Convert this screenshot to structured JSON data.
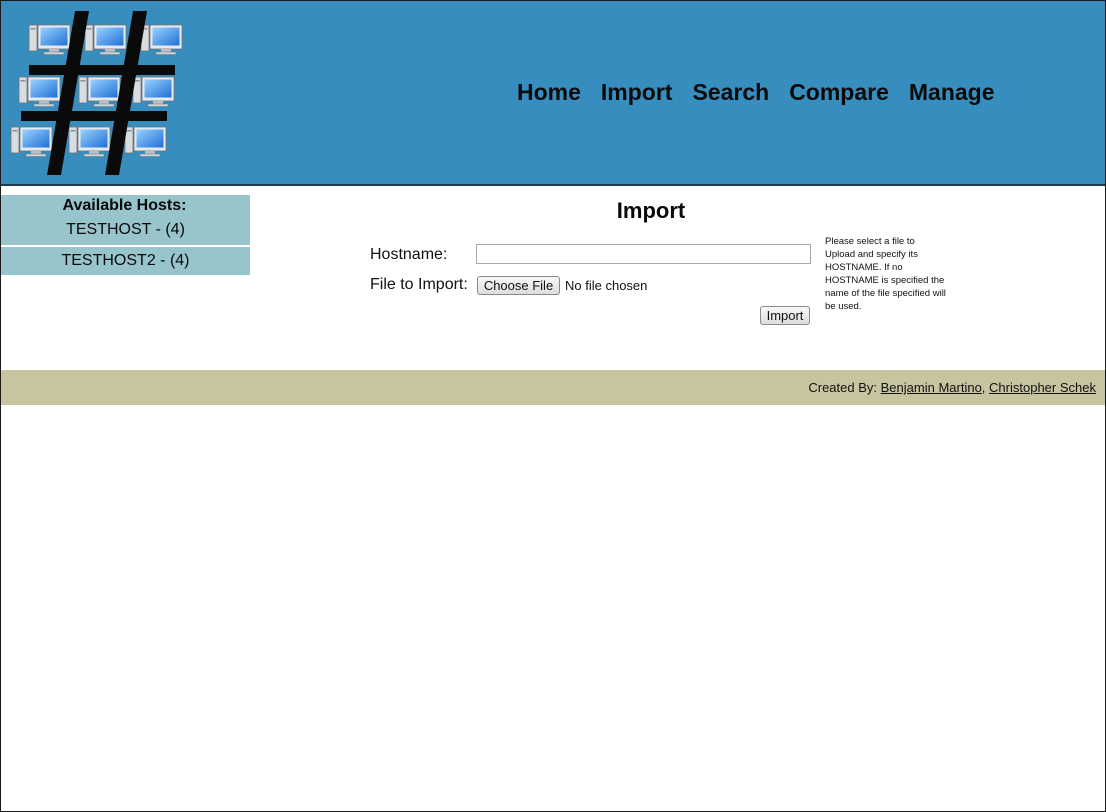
{
  "header": {
    "logo_icon": "hash-network-computers-icon",
    "nav": [
      {
        "label": "Home"
      },
      {
        "label": "Import"
      },
      {
        "label": "Search"
      },
      {
        "label": "Compare"
      },
      {
        "label": "Manage"
      }
    ]
  },
  "sidebar": {
    "title": "Available Hosts:",
    "hosts": [
      {
        "label": "TESTHOST - (4)"
      },
      {
        "label": "TESTHOST2 - (4)"
      }
    ]
  },
  "main": {
    "title": "Import",
    "hostname_label": "Hostname:",
    "hostname_value": "",
    "file_label": "File to Import:",
    "choose_file_label": "Choose File",
    "no_file_text": "No file chosen",
    "import_button_label": "Import",
    "help_text": "Please select a file to Upload and specify its HOSTNAME. If no HOSTNAME is specified the name of the file specified will be used."
  },
  "footer": {
    "created_by": "Created By:",
    "author1": "Benjamin Martino",
    "separator": ",",
    "author2": "Christopher Schek"
  },
  "colors": {
    "header_bg": "#378dbd",
    "sidebar_bg": "#97c5cb",
    "footer_bg": "#c9c4a0"
  }
}
